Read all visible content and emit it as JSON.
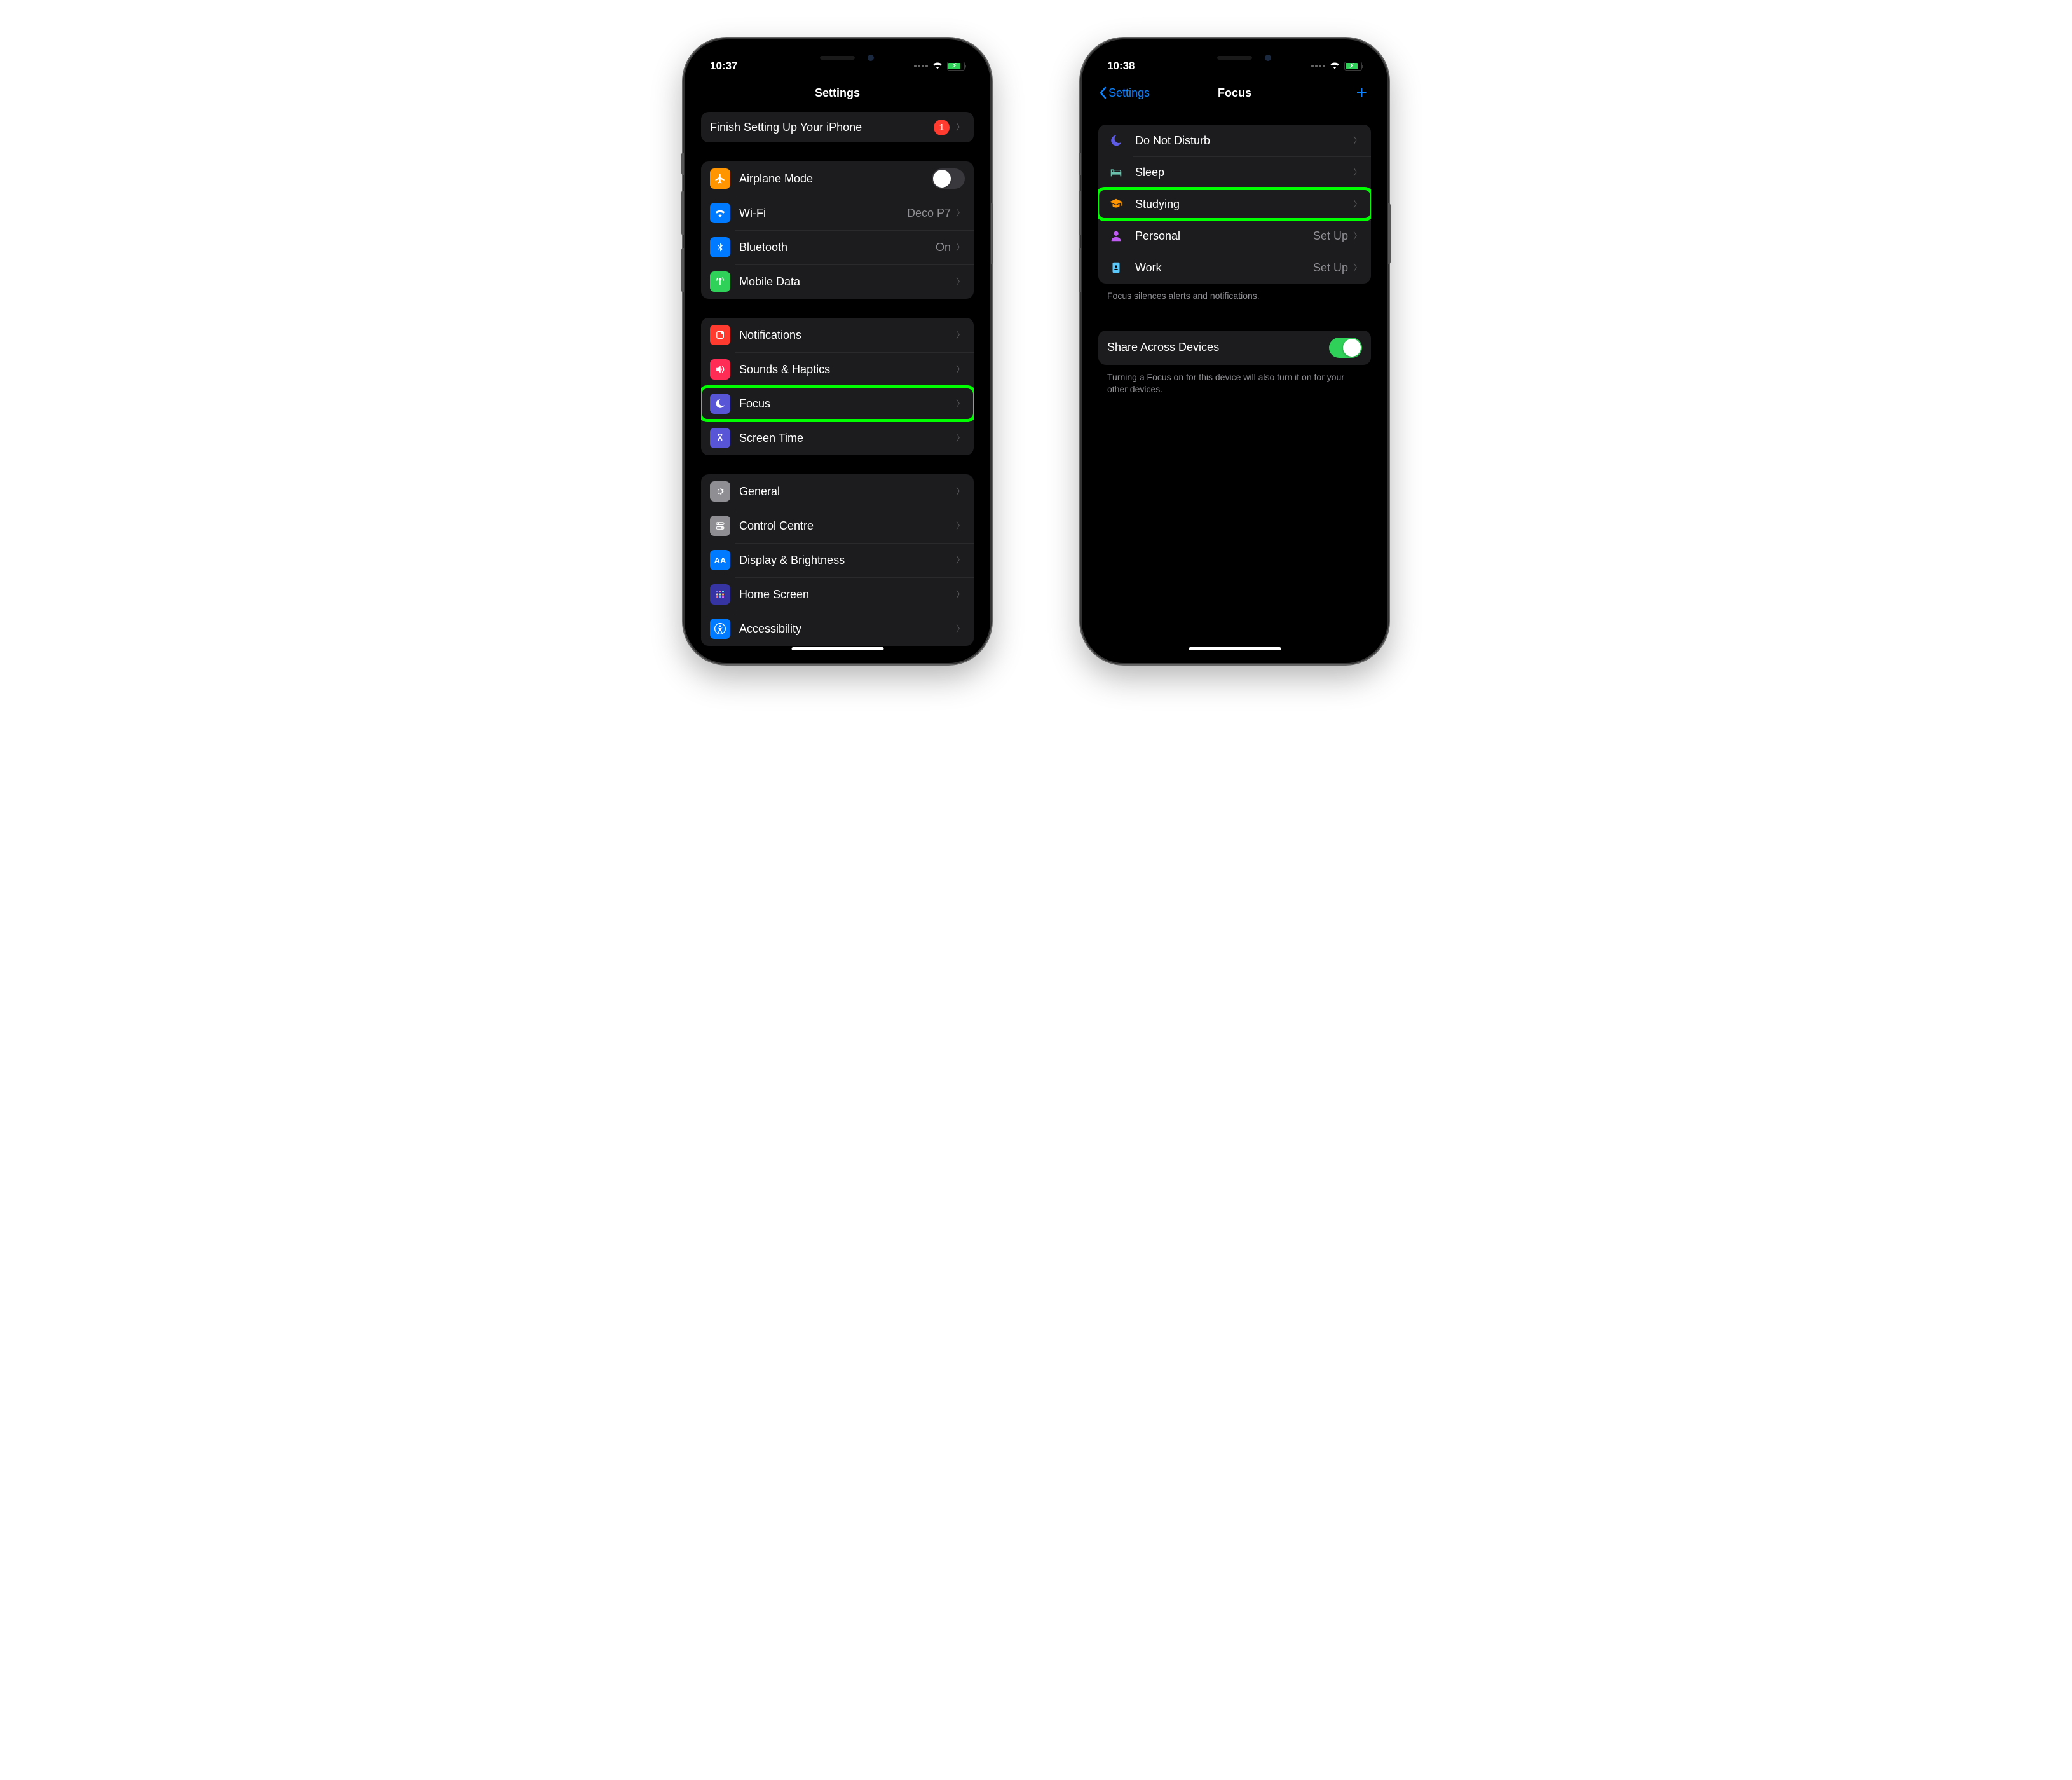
{
  "left": {
    "time": "10:37",
    "title": "Settings",
    "setup": {
      "label": "Finish Setting Up Your iPhone",
      "badge": "1"
    },
    "group1": [
      {
        "icon": "airplane",
        "color": "#ff9500",
        "label": "Airplane Mode",
        "toggle": false
      },
      {
        "icon": "wifi",
        "color": "#007aff",
        "label": "Wi-Fi",
        "detail": "Deco P7"
      },
      {
        "icon": "bluetooth",
        "color": "#007aff",
        "label": "Bluetooth",
        "detail": "On"
      },
      {
        "icon": "antenna",
        "color": "#30d158",
        "label": "Mobile Data"
      }
    ],
    "group2": [
      {
        "icon": "bell",
        "color": "#ff3b30",
        "label": "Notifications"
      },
      {
        "icon": "speaker",
        "color": "#ff2d55",
        "label": "Sounds & Haptics"
      },
      {
        "icon": "moon",
        "color": "#5856d6",
        "label": "Focus",
        "highlight": true
      },
      {
        "icon": "hourglass",
        "color": "#5856d6",
        "label": "Screen Time"
      }
    ],
    "group3": [
      {
        "icon": "gear",
        "color": "#8e8e93",
        "label": "General"
      },
      {
        "icon": "switches",
        "color": "#8e8e93",
        "label": "Control Centre"
      },
      {
        "icon": "aa",
        "color": "#007aff",
        "label": "Display & Brightness"
      },
      {
        "icon": "grid",
        "color": "#4b3cda",
        "label": "Home Screen"
      },
      {
        "icon": "accessibility",
        "color": "#007aff",
        "label": "Accessibility"
      }
    ]
  },
  "right": {
    "time": "10:38",
    "back": "Settings",
    "title": "Focus",
    "modes": [
      {
        "icon": "moon",
        "color": "#5e5ce6",
        "label": "Do Not Disturb"
      },
      {
        "icon": "bed",
        "color": "#6ac4ae",
        "label": "Sleep"
      },
      {
        "icon": "gradcap",
        "color": "#ff9500",
        "label": "Studying",
        "highlight": true
      },
      {
        "icon": "person",
        "color": "#bf5af2",
        "label": "Personal",
        "detail": "Set Up"
      },
      {
        "icon": "badge",
        "color": "#5ac8fa",
        "label": "Work",
        "detail": "Set Up"
      }
    ],
    "modes_footer": "Focus silences alerts and notifications.",
    "share": {
      "label": "Share Across Devices",
      "on": true
    },
    "share_footer": "Turning a Focus on for this device will also turn it on for your other devices."
  }
}
